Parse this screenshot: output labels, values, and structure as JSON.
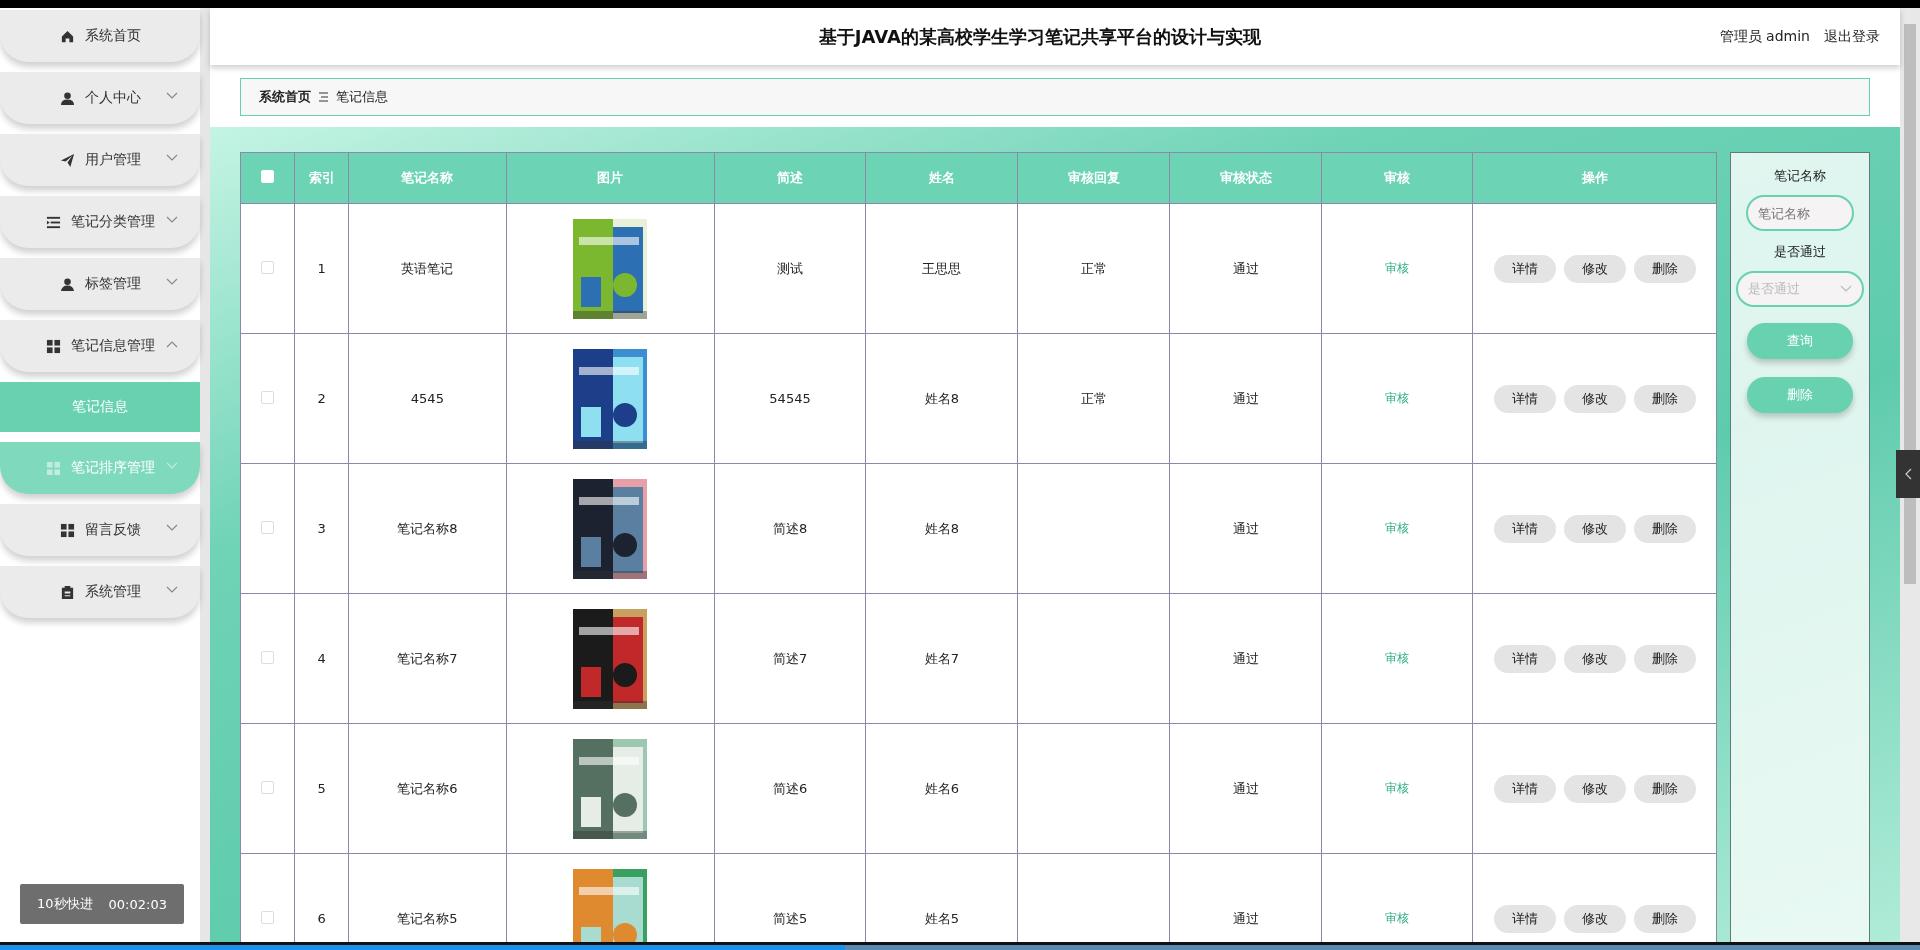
{
  "header": {
    "title": "基于JAVA的某高校学生学习笔记共享平台的设计与实现",
    "user": "管理员 admin",
    "logout": "退出登录"
  },
  "sidebar": {
    "items": [
      {
        "label": "系统首页",
        "expandable": false,
        "hovered": false
      },
      {
        "label": "个人中心",
        "expandable": true,
        "expanded": false,
        "hovered": false
      },
      {
        "label": "用户管理",
        "expandable": true,
        "expanded": false,
        "hovered": false
      },
      {
        "label": "笔记分类管理",
        "expandable": true,
        "expanded": false,
        "hovered": false
      },
      {
        "label": "标签管理",
        "expandable": true,
        "expanded": false,
        "hovered": false
      },
      {
        "label": "笔记信息管理",
        "expandable": true,
        "expanded": true,
        "hovered": false,
        "children": [
          {
            "label": "笔记信息",
            "selected": true
          }
        ]
      },
      {
        "label": "笔记排序管理",
        "expandable": true,
        "expanded": false,
        "hovered": true
      },
      {
        "label": "留言反馈",
        "expandable": true,
        "expanded": false,
        "hovered": false
      },
      {
        "label": "系统管理",
        "expandable": true,
        "expanded": false,
        "hovered": false
      }
    ]
  },
  "breadcrumb": [
    "系统首页",
    "笔记信息"
  ],
  "table": {
    "select_all": false,
    "columns": [
      "索引",
      "笔记名称",
      "图片",
      "简述",
      "姓名",
      "审核回复",
      "审核状态",
      "审核",
      "操作"
    ],
    "rows": [
      {
        "checked": false,
        "index": "1",
        "name": "英语笔记",
        "summary": "测试",
        "person": "王思思",
        "reply": "正常",
        "status": "通过",
        "review": "审核",
        "actions": [
          "详情",
          "修改",
          "删除"
        ]
      },
      {
        "checked": false,
        "index": "2",
        "name": "4545",
        "summary": "54545",
        "person": "姓名8",
        "reply": "正常",
        "status": "通过",
        "review": "审核",
        "actions": [
          "详情",
          "修改",
          "删除"
        ]
      },
      {
        "checked": false,
        "index": "3",
        "name": "笔记名称8",
        "summary": "简述8",
        "person": "姓名8",
        "status": "通过",
        "review": "审核",
        "actions": [
          "详情",
          "修改",
          "删除"
        ]
      },
      {
        "checked": false,
        "index": "4",
        "name": "笔记名称7",
        "summary": "简述7",
        "person": "姓名7",
        "status": "通过",
        "review": "审核",
        "actions": [
          "详情",
          "修改",
          "删除"
        ]
      },
      {
        "checked": false,
        "index": "5",
        "name": "笔记名称6",
        "summary": "简述6",
        "person": "姓名6",
        "status": "通过",
        "review": "审核",
        "actions": [
          "详情",
          "修改",
          "删除"
        ]
      },
      {
        "checked": false,
        "index": "6",
        "name": "笔记名称5",
        "summary": "简述5",
        "person": "姓名5",
        "status": "通过",
        "review": "审核",
        "actions": [
          "详情",
          "修改",
          "删除"
        ]
      }
    ]
  },
  "search": {
    "fields": [
      {
        "kind": "text",
        "label": "笔记名称",
        "placeholder": "笔记名称"
      },
      {
        "kind": "select",
        "label": "是否通过",
        "placeholder": "是否通过"
      }
    ],
    "buttons": [
      "查询",
      "删除"
    ]
  },
  "player": {
    "toast": "10秒快进",
    "time": "00:02:03",
    "level": 0.44
  }
}
